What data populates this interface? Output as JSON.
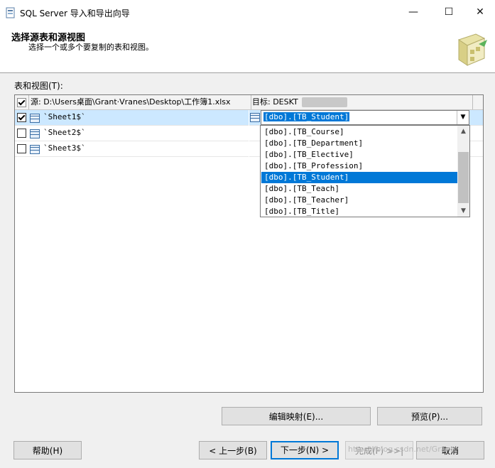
{
  "window": {
    "title": "SQL Server 导入和导出向导",
    "minimize_glyph": "—",
    "maximize_glyph": "☐",
    "close_glyph": "✕"
  },
  "header": {
    "title": "选择源表和源视图",
    "subtitle": "选择一个或多个要复制的表和视图。"
  },
  "tables_label": "表和视图(T):",
  "grid": {
    "source_header": "源: D:\\Users桌面\\Grant·Vranes\\Desktop\\工作簿1.xlsx",
    "target_header": "目标: DESKT",
    "rows": [
      {
        "checked": true,
        "name": "`Sheet1$`"
      },
      {
        "checked": false,
        "name": "`Sheet2$`"
      },
      {
        "checked": false,
        "name": "`Sheet3$`"
      }
    ],
    "target_combo_value": "[dbo].[TB_Student]",
    "dropdown_options": [
      "[dbo].[TB_Course]",
      "[dbo].[TB_Department]",
      "[dbo].[TB_Elective]",
      "[dbo].[TB_Profession]",
      "[dbo].[TB_Student]",
      "[dbo].[TB_Teach]",
      "[dbo].[TB_Teacher]",
      "[dbo].[TB_Title]"
    ],
    "selected_option_index": 4
  },
  "buttons": {
    "edit_mappings": "编辑映射(E)...",
    "preview": "预览(P)...",
    "help": "帮助(H)",
    "back": "< 上一步(B)",
    "next": "下一步(N) >",
    "finish": "完成(F) >>|",
    "cancel": "取消"
  },
  "watermark": "https://blog.csdn.net/Grantr",
  "colors": {
    "accent": "#0078d7",
    "row_selected": "#cce8ff",
    "dialog_background": "#f0f0f0"
  },
  "icons": {
    "app": "wizard-app-icon",
    "table": "table-icon",
    "logo": "wizard-logo"
  }
}
